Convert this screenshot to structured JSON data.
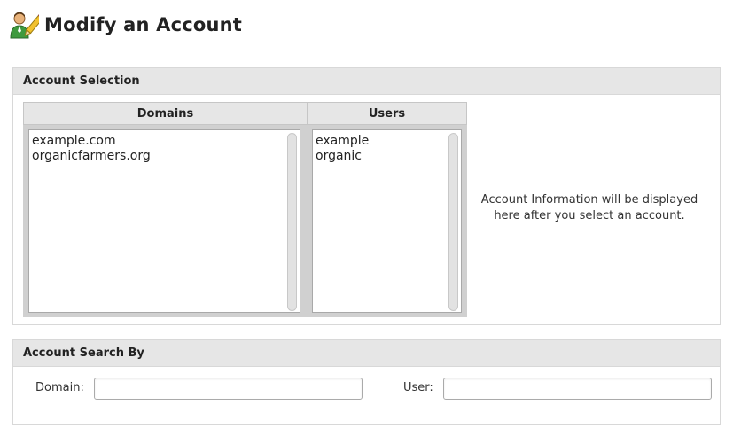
{
  "header": {
    "title": "Modify an Account",
    "icon": "user-edit-icon"
  },
  "account_selection": {
    "title": "Account Selection",
    "domains_header": "Domains",
    "users_header": "Users",
    "domains": [
      "example.com",
      "organicfarmers.org"
    ],
    "users": [
      "example",
      "organic"
    ],
    "info_line1": "Account Information will be displayed",
    "info_line2": "here after you select an account."
  },
  "account_search": {
    "title": "Account Search By",
    "domain_label": "Domain:",
    "domain_value": "",
    "user_label": "User:",
    "user_value": ""
  }
}
